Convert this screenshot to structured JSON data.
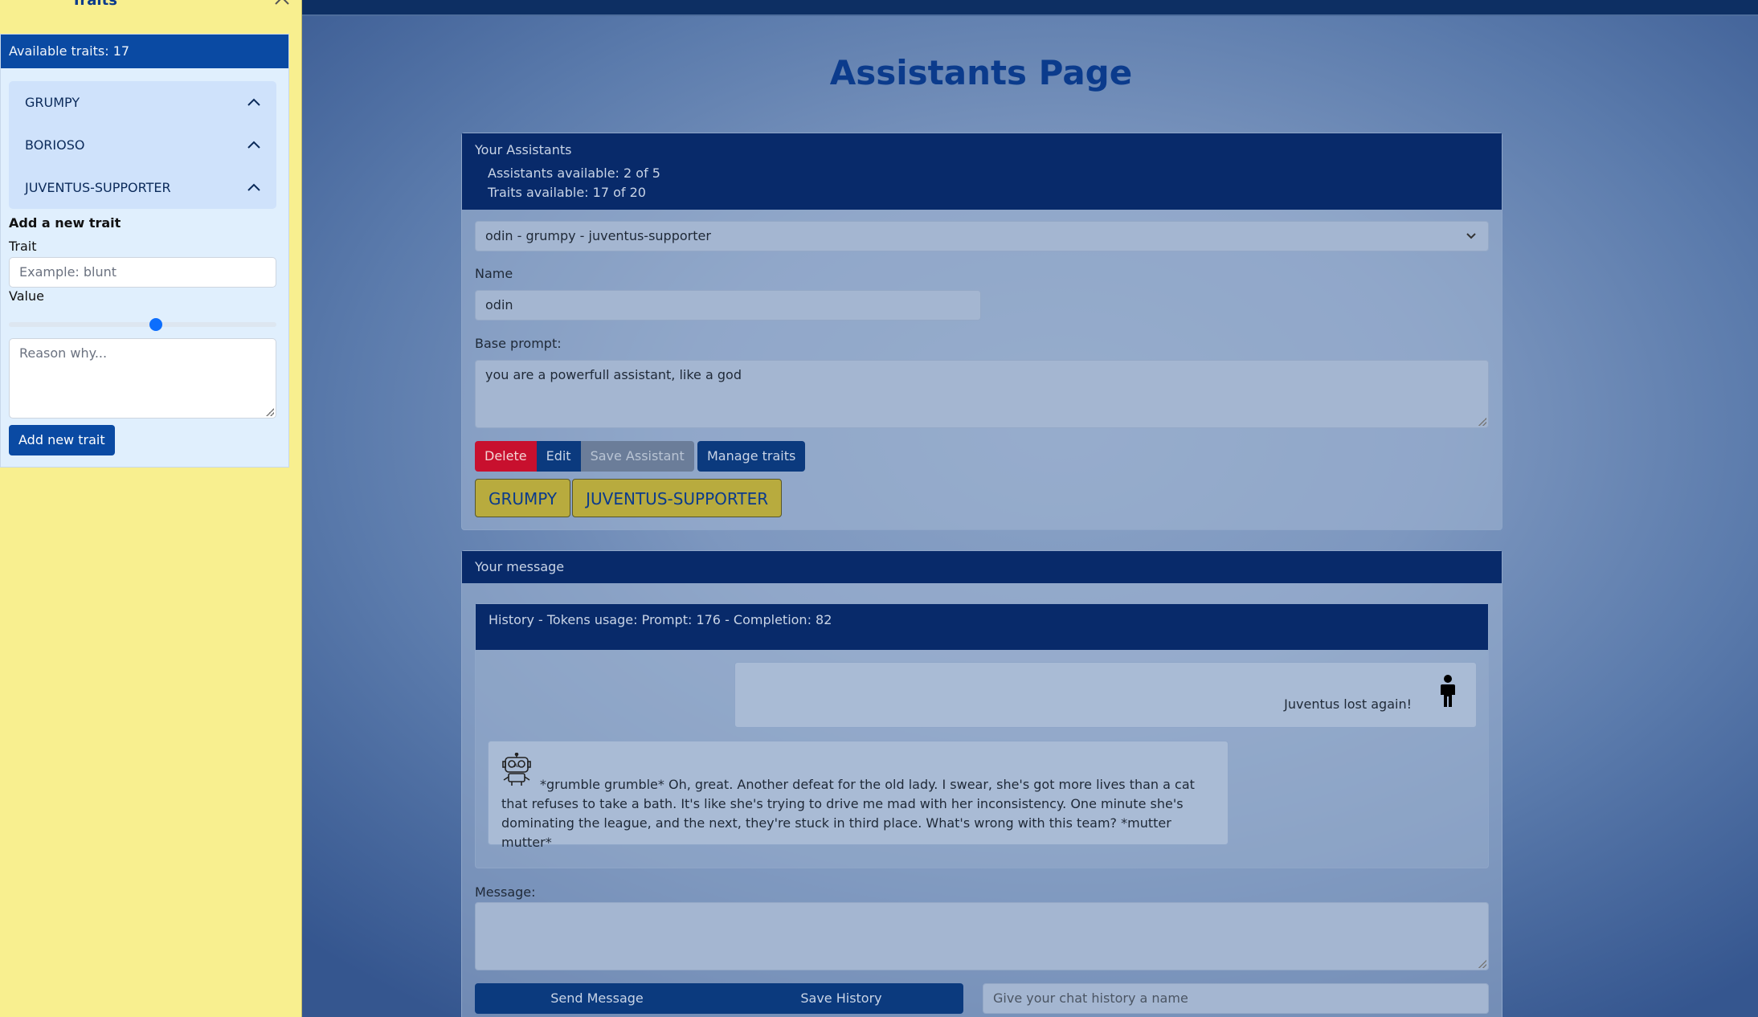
{
  "page": {
    "title": "Assistants Page"
  },
  "assistants": {
    "header": "Your Assistants",
    "available": "Assistants available: 2 of 5",
    "traits_available": "Traits available: 17 of 20",
    "selected": "odin - grumpy - juventus-supporter",
    "name_label": "Name",
    "name_value": "odin",
    "prompt_label": "Base prompt:",
    "prompt_value": "you are a powerfull assistant, like a god",
    "buttons": {
      "delete": "Delete",
      "edit": "Edit",
      "save": "Save Assistant",
      "manage": "Manage traits"
    },
    "tags": [
      "GRUMPY",
      "JUVENTUS-SUPPORTER"
    ]
  },
  "message": {
    "header": "Your message",
    "history_header": "History - Tokens usage: Prompt: 176 - Completion: 82",
    "user_message": "Juventus lost again!",
    "ai_message": "*grumble grumble* Oh, great. Another defeat for the old lady. I swear, she's got more lives than a cat that refuses to take a bath. It's like she's trying to drive me mad with her inconsistency. One minute she's dominating the league, and the next, they're stuck in third place. What's wrong with this team? *mutter mutter*",
    "message_label": "Message:",
    "send_label": "Send Message",
    "save_history_label": "Save History",
    "history_name_placeholder": "Give your chat history a name"
  },
  "traits_panel": {
    "title": "Traits",
    "available": "Available traits: 17",
    "items": [
      "GRUMPY",
      "BORIOSO",
      "JUVENTUS-SUPPORTER"
    ],
    "add_heading": "Add a new trait",
    "trait_label": "Trait",
    "trait_placeholder": "Example: blunt",
    "value_label": "Value",
    "value": 0.55,
    "reason_placeholder": "Reason why...",
    "add_button": "Add new trait"
  }
}
